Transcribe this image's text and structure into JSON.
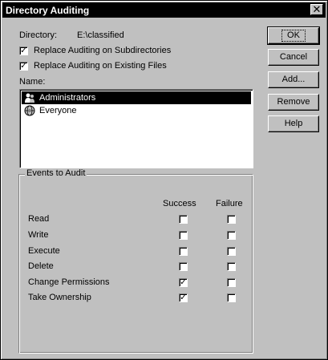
{
  "window": {
    "title": "Directory Auditing"
  },
  "directory": {
    "label": "Directory:",
    "value": "E:\\classified"
  },
  "options": [
    {
      "label": "Replace Auditing on Subdirectories",
      "checked": true
    },
    {
      "label": "Replace Auditing on Existing Files",
      "checked": true
    }
  ],
  "names": {
    "label": "Name:",
    "items": [
      {
        "label": "Administrators",
        "icon": "group-icon",
        "selected": true
      },
      {
        "label": "Everyone",
        "icon": "globe-icon",
        "selected": false
      }
    ]
  },
  "buttons": {
    "ok": "OK",
    "cancel": "Cancel",
    "add": "Add...",
    "remove": "Remove",
    "help": "Help"
  },
  "events": {
    "title": "Events to Audit",
    "success_header": "Success",
    "failure_header": "Failure",
    "rows": [
      {
        "label": "Read",
        "success": false,
        "failure": false
      },
      {
        "label": "Write",
        "success": false,
        "failure": false
      },
      {
        "label": "Execute",
        "success": false,
        "failure": false
      },
      {
        "label": "Delete",
        "success": false,
        "failure": false
      },
      {
        "label": "Change Permissions",
        "success": true,
        "failure": false
      },
      {
        "label": "Take Ownership",
        "success": true,
        "failure": false
      }
    ]
  },
  "colors": {
    "selection": "#000000",
    "face": "#c0c0c0"
  }
}
